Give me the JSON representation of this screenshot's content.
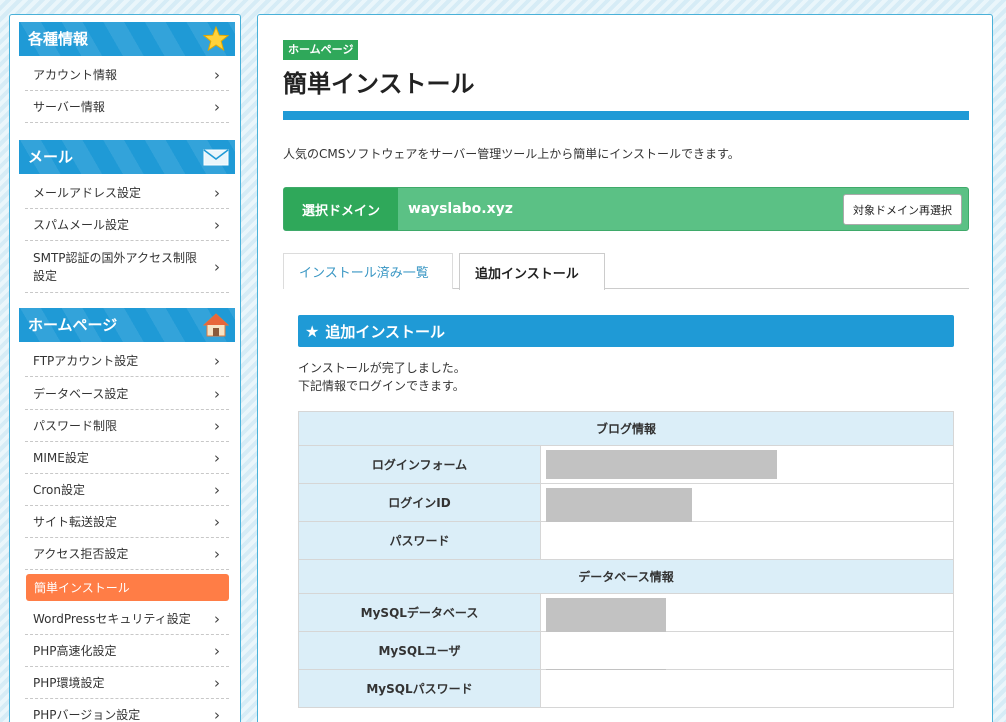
{
  "sidebar": {
    "sections": [
      {
        "title": "各種情報",
        "icon": "star-icon",
        "items": [
          "アカウント情報",
          "サーバー情報"
        ]
      },
      {
        "title": "メール",
        "icon": "envelope-icon",
        "items": [
          "メールアドレス設定",
          "スパムメール設定",
          "SMTP認証の国外アクセス制限設定"
        ]
      },
      {
        "title": "ホームページ",
        "icon": "house-icon",
        "items": [
          "FTPアカウント設定",
          "データベース設定",
          "パスワード制限",
          "MIME設定",
          "Cron設定",
          "サイト転送設定",
          "アクセス拒否設定",
          "簡単インストール",
          "WordPressセキュリティ設定",
          "PHP高速化設定",
          "PHP環境設定",
          "PHPバージョン設定"
        ]
      }
    ],
    "smtp_line1": "SMTP認証の国外アクセス制限",
    "smtp_line2": "設定",
    "chevron": "›"
  },
  "main": {
    "badge": "ホームページ",
    "title": "簡単インストール",
    "intro": "人気のCMSソフトウェアをサーバー管理ツール上から簡単にインストールできます。",
    "domain": {
      "label": "選択ドメイン",
      "value": "wayslabo.xyz",
      "button": "対象ドメイン再選択"
    },
    "tabs": {
      "installed": "インストール済み一覧",
      "add": "追加インストール"
    },
    "panel_title": "追加インストール",
    "messages": [
      "インストールが完了しました。",
      "下記情報でログインできます。"
    ],
    "table": {
      "blog_group": "ブログ情報",
      "login_form": "ログインフォーム",
      "login_id": "ログインID",
      "password": "パスワード",
      "db_group": "データベース情報",
      "mysql_db": "MySQLデータベース",
      "mysql_user": "MySQLユーザ",
      "mysql_password": "MySQLパスワード"
    }
  },
  "colors": {
    "accent": "#1f9ad6",
    "green": "#2fa85a",
    "active_nav": "#ff7d46"
  }
}
